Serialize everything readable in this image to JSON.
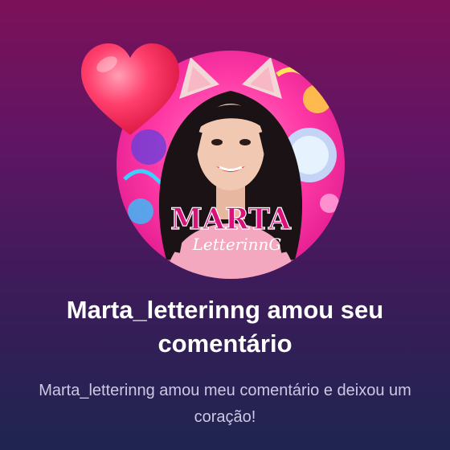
{
  "notification": {
    "title": "Marta_letterinng amou seu comentário",
    "message": "Marta_letterinng amou meu comentário e deixou um coração!"
  },
  "avatar": {
    "logo_main": "MARTA",
    "logo_script": "LetterinnG"
  },
  "icons": {
    "heart": "heart-icon"
  },
  "colors": {
    "background_top": "#7c1158",
    "background_bottom": "#1e2550",
    "heart": "#ff3b6b",
    "avatar_ring": "#ff3aa6"
  }
}
